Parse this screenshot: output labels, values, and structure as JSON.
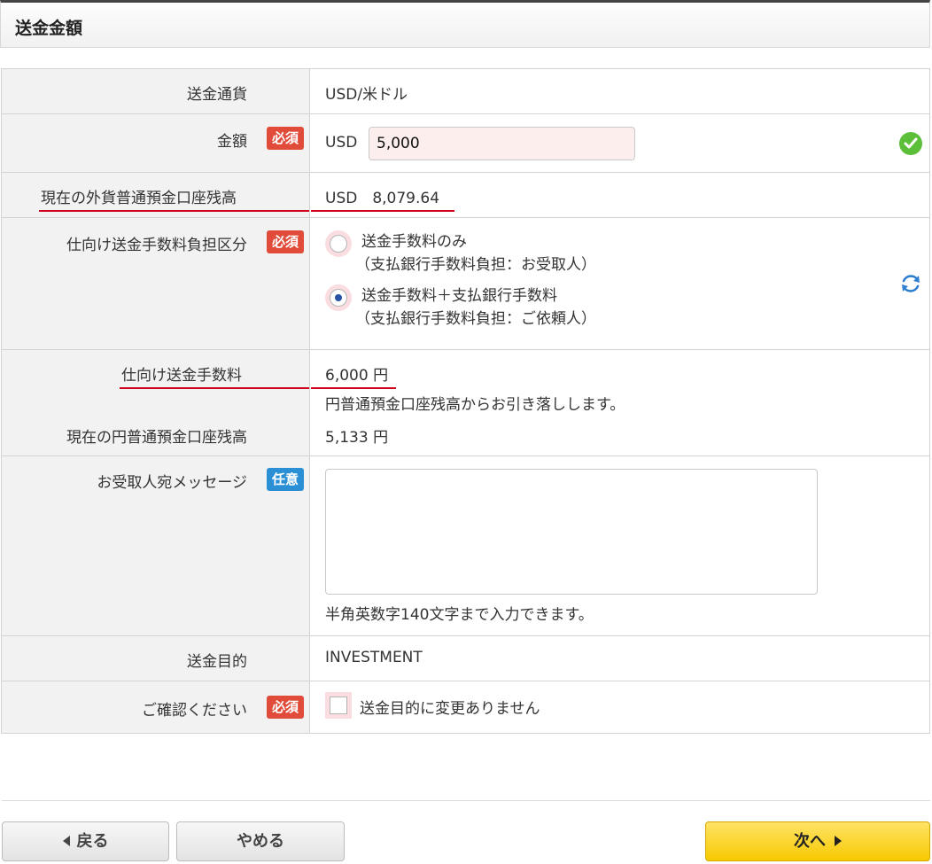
{
  "header": {
    "title": "送金金額"
  },
  "rows": {
    "currency": {
      "label": "送金通貨",
      "value": "USD/米ドル"
    },
    "amount": {
      "label": "金額",
      "badge": "必須",
      "unit": "USD",
      "input_value": "5,000"
    },
    "fx_balance": {
      "label": "現在の外貨普通預金口座残高",
      "value": "USD　8,079.64"
    },
    "fee_burden": {
      "label": "仕向け送金手数料負担区分",
      "badge": "必須",
      "options": [
        {
          "line1": "送金手数料のみ",
          "line2": "（支払銀行手数料負担：お受取人）",
          "selected": false
        },
        {
          "line1": "送金手数料＋支払銀行手数料",
          "line2": "（支払銀行手数料負担：ご依頼人）",
          "selected": true
        }
      ]
    },
    "remit_fee": {
      "label": "仕向け送金手数料",
      "value": "6,000 円",
      "note": "円普通預金口座残高からお引き落しします。",
      "jpy_label": "現在の円普通預金口座残高",
      "jpy_value": "5,133 円"
    },
    "message": {
      "label": "お受取人宛メッセージ",
      "badge": "任意",
      "value": "",
      "hint": "半角英数字140文字まで入力できます。"
    },
    "purpose": {
      "label": "送金目的",
      "value": "INVESTMENT"
    },
    "confirm": {
      "label": "ご確認ください",
      "badge": "必須",
      "checkbox_label": "送金目的に変更ありません",
      "checked": false
    }
  },
  "buttons": {
    "back": "戻る",
    "cancel": "やめる",
    "next": "次へ"
  },
  "colors": {
    "required_badge": "#e04b3a",
    "optional_badge": "#2b8fd6",
    "next_button": "#f7c900",
    "highlight_underline": "#d0021b"
  },
  "icons": {
    "amount_status": "check-circle-icon",
    "fee_refresh": "refresh-icon"
  }
}
